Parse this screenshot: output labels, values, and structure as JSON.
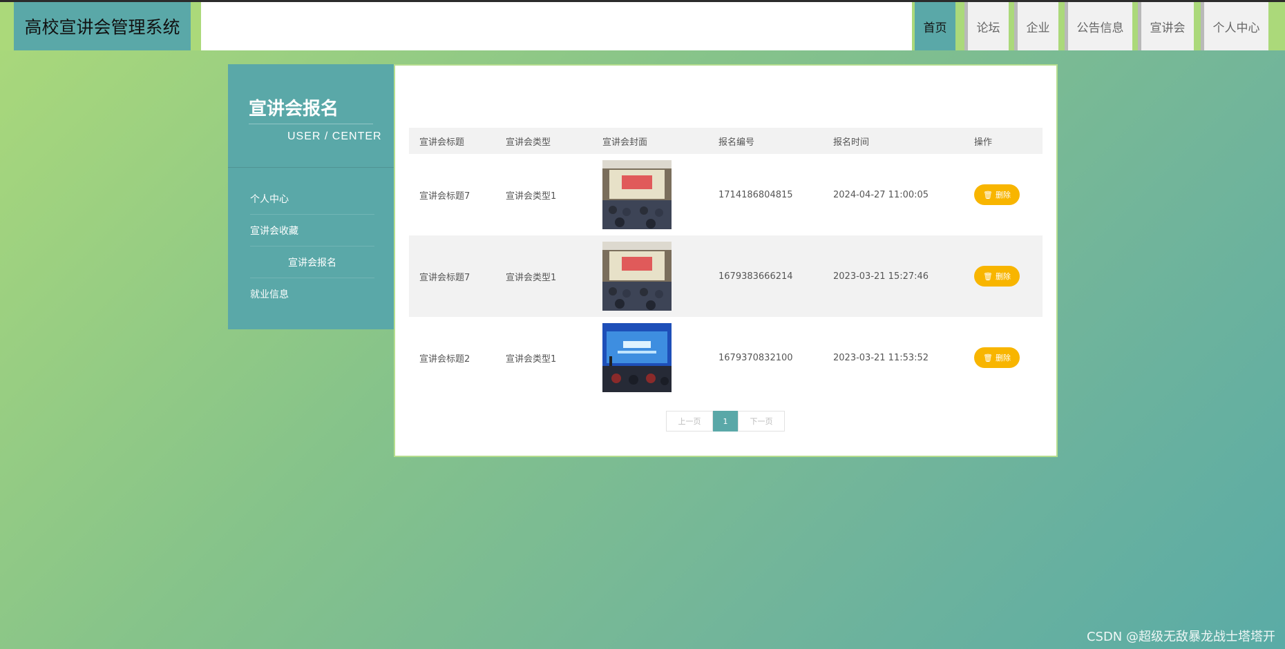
{
  "header": {
    "logo": "高校宣讲会管理系统",
    "nav": [
      "首页",
      "论坛",
      "企业",
      "公告信息",
      "宣讲会",
      "个人中心"
    ]
  },
  "sidebar": {
    "title": "宣讲会报名",
    "subtitle": "USER / CENTER",
    "items": [
      "个人中心",
      "宣讲会收藏",
      "宣讲会报名",
      "就业信息"
    ]
  },
  "table": {
    "headers": [
      "宣讲会标题",
      "宣讲会类型",
      "宣讲会封面",
      "报名编号",
      "报名时间",
      "操作"
    ],
    "rows": [
      {
        "title": "宣讲会标题7",
        "type": "宣讲会类型1",
        "code": "1714186804815",
        "time": "2024-04-27 11:00:05",
        "action": "删除"
      },
      {
        "title": "宣讲会标题7",
        "type": "宣讲会类型1",
        "code": "1679383666214",
        "time": "2023-03-21 15:27:46",
        "action": "删除"
      },
      {
        "title": "宣讲会标题2",
        "type": "宣讲会类型1",
        "code": "1679370832100",
        "time": "2023-03-21 11:53:52",
        "action": "删除"
      }
    ]
  },
  "pager": {
    "prev": "上一页",
    "current": "1",
    "next": "下一页"
  },
  "watermark": "CSDN @超级无敌暴龙战士塔塔开",
  "colors": {
    "accent": "#5aa8a8",
    "delete": "#f8b500",
    "bg_start": "#abd97a",
    "bg_end": "#5aaba6"
  }
}
